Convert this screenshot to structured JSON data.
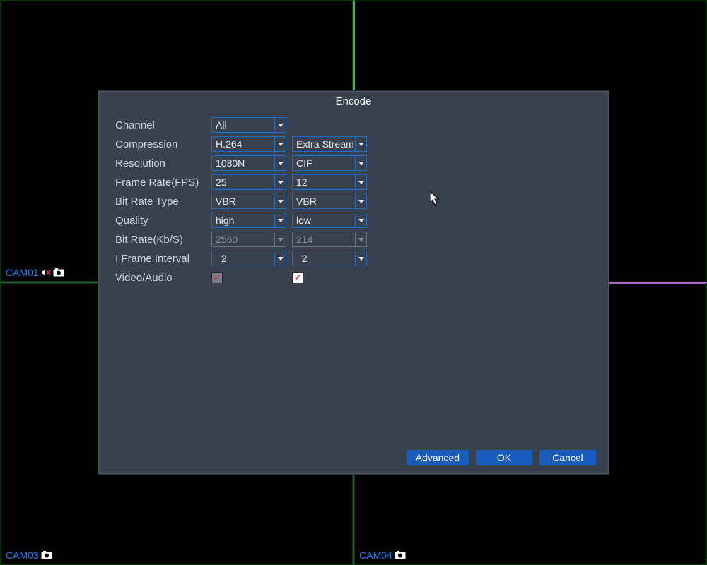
{
  "cameras": {
    "tl": "CAM01",
    "bl": "CAM03",
    "br": "CAM04"
  },
  "dialog": {
    "title": "Encode",
    "labels": {
      "channel": "Channel",
      "compression": "Compression",
      "resolution": "Resolution",
      "framerate": "Frame Rate(FPS)",
      "bitratetype": "Bit Rate Type",
      "quality": "Quality",
      "bitrate": "Bit Rate(Kb/S)",
      "iframe": "I Frame Interval",
      "videoaudio": "Video/Audio"
    },
    "main": {
      "channel": "All",
      "compression": "H.264",
      "resolution": "1080N",
      "framerate": "25",
      "bitratetype": "VBR",
      "quality": "high",
      "bitrate": "2560",
      "iframe": "  2"
    },
    "extra": {
      "compression": "Extra Stream",
      "resolution": "CIF",
      "framerate": "12",
      "bitratetype": "VBR",
      "quality": "low",
      "bitrate": "214",
      "iframe": "  2"
    },
    "buttons": {
      "advanced": "Advanced",
      "ok": "OK",
      "cancel": "Cancel"
    }
  }
}
